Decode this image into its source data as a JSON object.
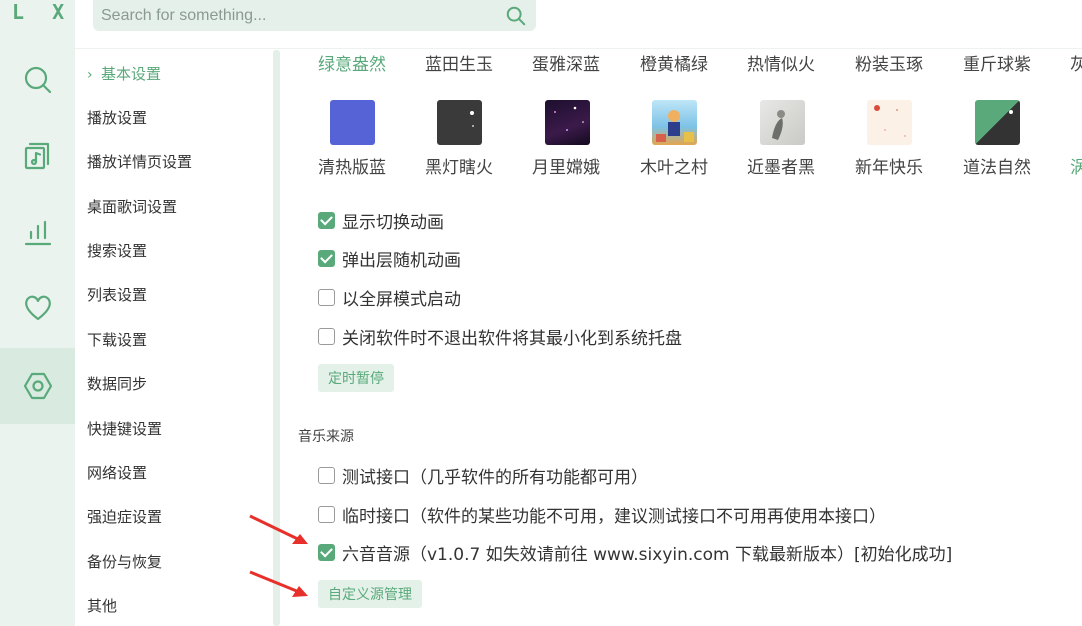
{
  "app": {
    "logo": "L X"
  },
  "search": {
    "placeholder": "Search for something..."
  },
  "rail": {
    "items": [
      {
        "name": "search",
        "icon": "search-icon"
      },
      {
        "name": "music-list",
        "icon": "music-list-icon"
      },
      {
        "name": "leaderboard",
        "icon": "chart-bars-icon"
      },
      {
        "name": "favorites",
        "icon": "heart-icon"
      },
      {
        "name": "settings",
        "icon": "hexagon-settings-icon",
        "active": true
      }
    ]
  },
  "nav": {
    "items": [
      {
        "label": "基本设置",
        "active": true
      },
      {
        "label": "播放设置"
      },
      {
        "label": "播放详情页设置"
      },
      {
        "label": "桌面歌词设置"
      },
      {
        "label": "搜索设置"
      },
      {
        "label": "列表设置"
      },
      {
        "label": "下载设置"
      },
      {
        "label": "数据同步"
      },
      {
        "label": "快捷键设置"
      },
      {
        "label": "网络设置"
      },
      {
        "label": "强迫症设置"
      },
      {
        "label": "备份与恢复"
      },
      {
        "label": "其他"
      }
    ]
  },
  "themes": {
    "row1": [
      "绿意盎然",
      "蓝田生玉",
      "蛋雅深蓝",
      "橙黄橘绿",
      "热情似火",
      "粉装玉琢",
      "重斤球紫",
      "灰"
    ],
    "row2": [
      "清热版蓝",
      "黑灯瞎火",
      "月里嫦娥",
      "木叶之村",
      "近墨者黑",
      "新年快乐",
      "道法自然",
      "涡"
    ],
    "selected": "绿意盎然",
    "accent": "#5aa97b"
  },
  "options": [
    {
      "label": "显示切换动画",
      "checked": true
    },
    {
      "label": "弹出层随机动画",
      "checked": true
    },
    {
      "label": "以全屏模式启动",
      "checked": false
    },
    {
      "label": "关闭软件时不退出软件将其最小化到系统托盘",
      "checked": false
    }
  ],
  "timer_button": "定时暂停",
  "music_source": {
    "title": "音乐来源",
    "items": [
      {
        "label": "测试接口（几乎软件的所有功能都可用）",
        "checked": false
      },
      {
        "label": "临时接口（软件的某些功能不可用，建议测试接口不可用再使用本接口）",
        "checked": false
      },
      {
        "label": "六音音源（v1.0.7 如失效请前往 www.sixyin.com 下载最新版本）[初始化成功]",
        "checked": true
      }
    ],
    "custom_button": "自定义源管理"
  }
}
